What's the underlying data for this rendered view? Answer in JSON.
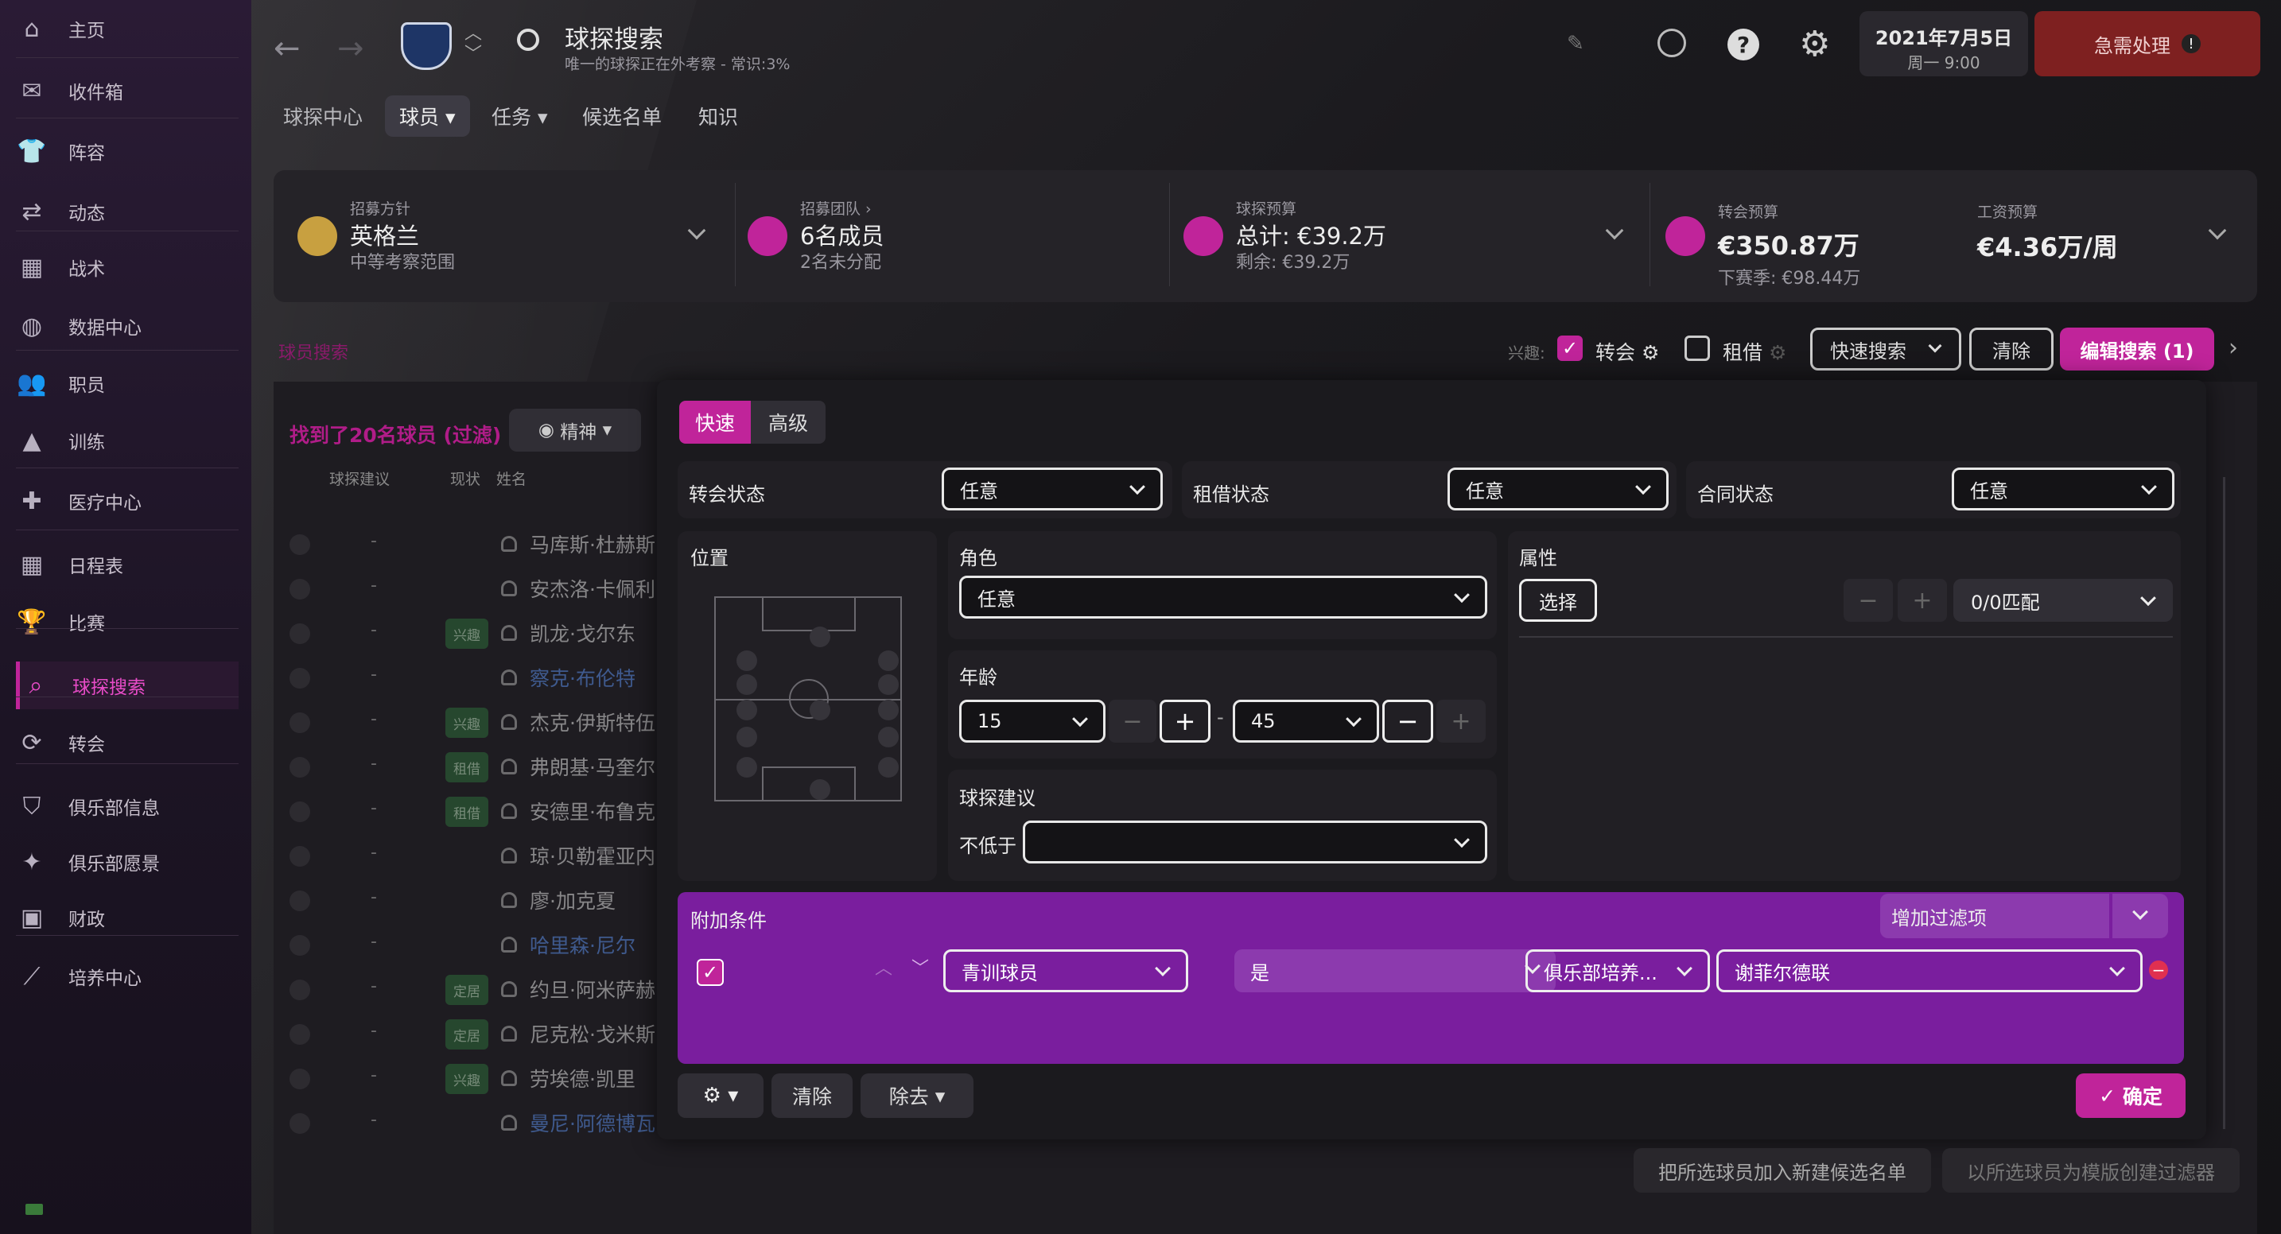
{
  "sidebar": {
    "items": [
      {
        "label": "主页",
        "icon": "home-icon",
        "glyph": "⌂"
      },
      {
        "label": "收件箱",
        "icon": "inbox-icon",
        "glyph": "✉"
      },
      {
        "label": "阵容",
        "icon": "squad-icon",
        "glyph": "👕"
      },
      {
        "label": "动态",
        "icon": "dynamics-icon",
        "glyph": "⇄"
      },
      {
        "label": "战术",
        "icon": "tactics-icon",
        "glyph": "▦"
      },
      {
        "label": "数据中心",
        "icon": "data-hub-icon",
        "glyph": "◍"
      },
      {
        "label": "职员",
        "icon": "staff-icon",
        "glyph": "👥"
      },
      {
        "label": "训练",
        "icon": "training-icon",
        "glyph": "▲"
      },
      {
        "label": "医疗中心",
        "icon": "medical-icon",
        "glyph": "✚"
      },
      {
        "label": "日程表",
        "icon": "schedule-icon",
        "glyph": "▦"
      },
      {
        "label": "比赛",
        "icon": "trophy-icon",
        "glyph": "🏆"
      },
      {
        "label": "球探搜索",
        "icon": "search-icon",
        "glyph": "⌕"
      },
      {
        "label": "转会",
        "icon": "transfer-icon",
        "glyph": "⟳"
      },
      {
        "label": "俱乐部信息",
        "icon": "shield-icon",
        "glyph": "⛉"
      },
      {
        "label": "俱乐部愿景",
        "icon": "vision-icon",
        "glyph": "✦"
      },
      {
        "label": "财政",
        "icon": "finance-icon",
        "glyph": "▣"
      },
      {
        "label": "培养中心",
        "icon": "development-icon",
        "glyph": "⟋"
      }
    ]
  },
  "header": {
    "title": "球探搜索",
    "subtitle": "唯一的球探正在外考察 - 常识:3%",
    "date": "2021年7月5日",
    "weekday_time": "周一 9:00",
    "urgent": "急需处理"
  },
  "tabs": [
    "球探中心",
    "球员",
    "任务",
    "候选名单",
    "知识"
  ],
  "summary": {
    "recruit_label": "招募方针",
    "recruit_value": "英格兰",
    "recruit_sub": "中等考察范围",
    "team_label": "招募团队",
    "team_value": "6名成员",
    "team_sub": "2名未分配",
    "scout_budget_label": "球探预算",
    "scout_budget_value": "总计: €39.2万",
    "scout_budget_sub": "剩余: €39.2万",
    "transfer_label": "转会预算",
    "transfer_value": "€350.87万",
    "transfer_sub": "下赛季: €98.44万",
    "wage_label": "工资预算",
    "wage_value": "€4.36万/周"
  },
  "filterbar": {
    "section": "球员搜索",
    "interest": "兴趣:",
    "transfer": "转会",
    "loan": "租借",
    "quick_search": "快速搜索",
    "clear": "清除",
    "edit_search": "编辑搜索 (1)"
  },
  "results": {
    "found": "找到了20名球员 (过滤)",
    "view": "精神",
    "col_advice": "球探建议",
    "col_status": "现状",
    "col_name": "姓名"
  },
  "players": [
    {
      "name": "马库斯·杜赫斯",
      "tag": "",
      "link": false
    },
    {
      "name": "安杰洛·卡佩利",
      "tag": "",
      "link": false
    },
    {
      "name": "凯龙·戈尔东",
      "tag": "兴趣",
      "link": false
    },
    {
      "name": "察克·布伦特",
      "tag": "",
      "link": true
    },
    {
      "name": "杰克·伊斯特伍",
      "tag": "兴趣",
      "link": false
    },
    {
      "name": "弗朗基·马奎尔",
      "tag": "租借",
      "link": false
    },
    {
      "name": "安德里·布鲁克",
      "tag": "租借",
      "link": false
    },
    {
      "name": "琼·贝勒霍亚内",
      "tag": "",
      "link": false
    },
    {
      "name": "廖·加克夏",
      "tag": "",
      "link": false
    },
    {
      "name": "哈里森·尼尔",
      "tag": "",
      "link": true
    },
    {
      "name": "约旦·阿米萨赫",
      "tag": "定居",
      "link": false
    },
    {
      "name": "尼克松·戈米斯",
      "tag": "定居",
      "link": false
    },
    {
      "name": "劳埃德·凯里",
      "tag": "兴趣",
      "link": false
    },
    {
      "name": "曼尼·阿德博瓦",
      "tag": "",
      "link": true
    }
  ],
  "panel": {
    "tab_quick": "快速",
    "tab_advanced": "高级",
    "transfer_status": "转会状态",
    "loan_status": "租借状态",
    "contract_status": "合同状态",
    "any": "任意",
    "position": "位置",
    "role": "角色",
    "attributes": "属性",
    "select": "选择",
    "match": "0/0匹配",
    "age": "年龄",
    "age_min": "15",
    "age_max": "45",
    "scout_advice": "球探建议",
    "not_below": "不低于",
    "extra": "附加条件",
    "add_filter": "增加过滤项",
    "cond_field": "青训球员",
    "cond_op": "是",
    "cond_type": "俱乐部培养...",
    "cond_club": "谢菲尔德联",
    "clear": "清除",
    "remove": "除去",
    "confirm": "确定"
  },
  "footer": {
    "add_shortlist": "把所选球员加入新建候选名单",
    "create_filter": "以所选球员为模版创建过滤器"
  },
  "colors": {
    "accent": "#c0249a",
    "purple": "#7a1e9e",
    "urgent": "#7e2020"
  }
}
